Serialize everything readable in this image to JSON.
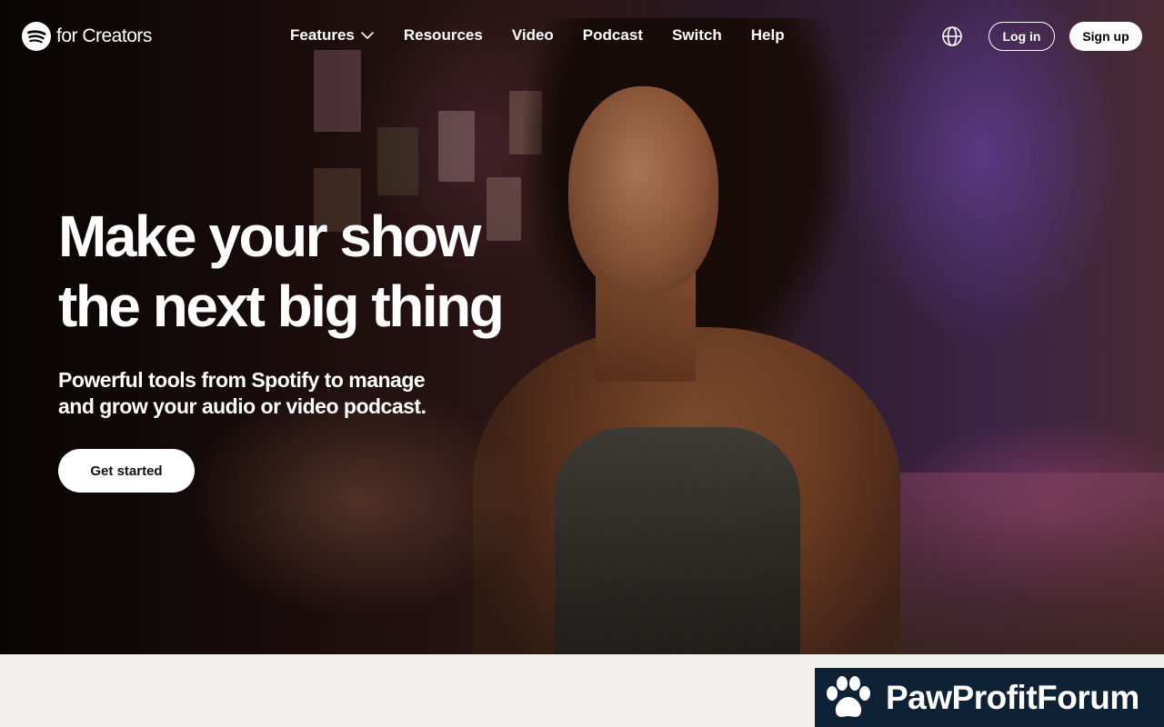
{
  "brand": {
    "logo_text": "for Creators",
    "logo_icon": "spotify-icon"
  },
  "nav": {
    "links": [
      {
        "label": "Features",
        "has_dropdown": true
      },
      {
        "label": "Resources"
      },
      {
        "label": "Video"
      },
      {
        "label": "Podcast"
      },
      {
        "label": "Switch"
      },
      {
        "label": "Help"
      }
    ],
    "language_icon": "globe-icon",
    "login_label": "Log in",
    "signup_label": "Sign up"
  },
  "hero": {
    "headline_line1": "Make your show",
    "headline_line2": "the next big thing",
    "subhead_line1": "Powerful tools from Spotify to manage",
    "subhead_line2": "and grow your audio or video podcast.",
    "cta_label": "Get started"
  },
  "watermark": {
    "text": "PawProfitForum",
    "icon": "paw-icon"
  },
  "colors": {
    "page_bg": "#f0efeb",
    "button_bg": "#ffffff",
    "watermark_bg": "#0e2236"
  }
}
